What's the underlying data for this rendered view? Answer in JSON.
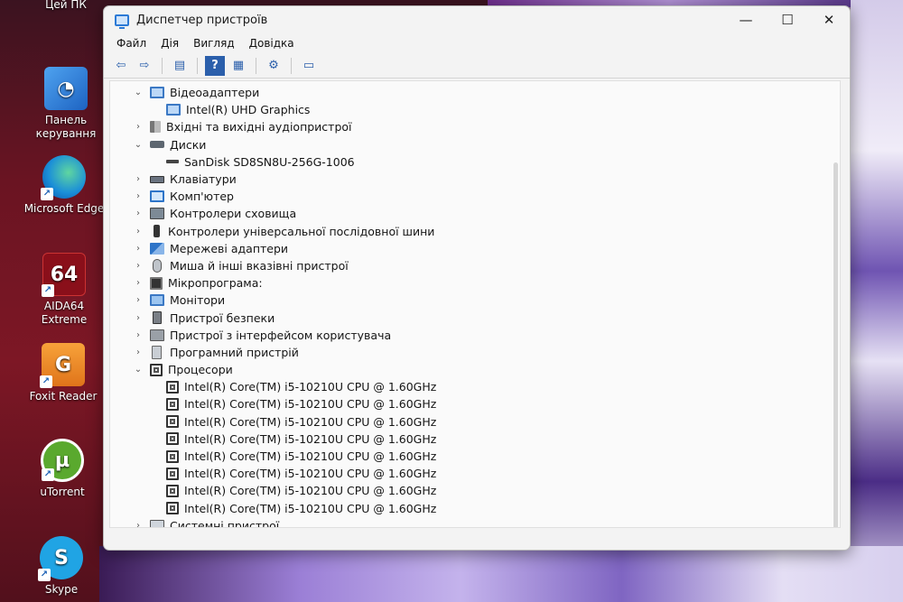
{
  "desktop": {
    "icons": [
      {
        "label": "Цей ПК"
      },
      {
        "label": "Панель керування"
      },
      {
        "label": "Microsoft Edge"
      },
      {
        "label": "AIDA64 Extreme"
      },
      {
        "label": "Foxit Reader"
      },
      {
        "label": "uTorrent"
      },
      {
        "label": "Skype"
      }
    ]
  },
  "window": {
    "title": "Диспетчер пристроїв",
    "controls": {
      "minimize": "—",
      "maximize": "☐",
      "close": "✕"
    }
  },
  "menu": [
    "Файл",
    "Дія",
    "Вигляд",
    "Довідка"
  ],
  "toolbar": {
    "back": "⇦",
    "forward": "⇨",
    "properties": "▤",
    "help": "?",
    "view": "▦",
    "scan": "⚙",
    "monitor": "▭"
  },
  "tree": {
    "video": {
      "label": "Відеоадаптери",
      "children": [
        "Intel(R) UHD Graphics"
      ]
    },
    "audio": {
      "label": "Вхідні та вихідні аудіопристрої"
    },
    "disks": {
      "label": "Диски",
      "children": [
        "SanDisk SD8SN8U-256G-1006"
      ]
    },
    "keyboards": {
      "label": "Клавіатури"
    },
    "computer": {
      "label": "Комп'ютер"
    },
    "storage": {
      "label": "Контролери сховища"
    },
    "usb": {
      "label": "Контролери універсальної послідовної шини"
    },
    "network": {
      "label": "Мережеві адаптери"
    },
    "mouse": {
      "label": "Миша й інші вказівні пристрої"
    },
    "firmware": {
      "label": "Мікропрограма:"
    },
    "monitors": {
      "label": "Монітори"
    },
    "security": {
      "label": "Пристрої безпеки"
    },
    "hid": {
      "label": "Пристрої з інтерфейсом користувача"
    },
    "software": {
      "label": "Програмний пристрій"
    },
    "cpu": {
      "label": "Процесори",
      "children": [
        "Intel(R) Core(TM) i5-10210U CPU @ 1.60GHz",
        "Intel(R) Core(TM) i5-10210U CPU @ 1.60GHz",
        "Intel(R) Core(TM) i5-10210U CPU @ 1.60GHz",
        "Intel(R) Core(TM) i5-10210U CPU @ 1.60GHz",
        "Intel(R) Core(TM) i5-10210U CPU @ 1.60GHz",
        "Intel(R) Core(TM) i5-10210U CPU @ 1.60GHz",
        "Intel(R) Core(TM) i5-10210U CPU @ 1.60GHz",
        "Intel(R) Core(TM) i5-10210U CPU @ 1.60GHz"
      ]
    },
    "system": {
      "label": "Системні пристрої"
    },
    "expanded_glyph": "⌄",
    "collapsed_glyph": "›"
  }
}
